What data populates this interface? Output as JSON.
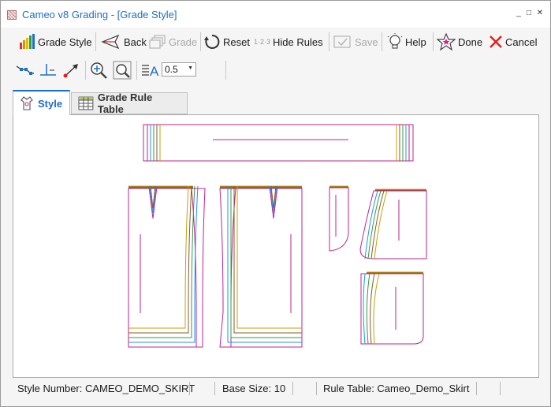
{
  "window": {
    "title": "Cameo v8 Grading - [Grade Style]",
    "controls": [
      "_",
      "□",
      "✕"
    ]
  },
  "toolbar": {
    "grade_style": "Grade Style",
    "back": "Back",
    "grade": "Grade",
    "reset": "Reset",
    "hide_rules_prefix": "1·2·3",
    "hide_rules": "Hide Rules",
    "save": "Save",
    "help": "Help",
    "done": "Done",
    "cancel": "Cancel"
  },
  "toolbar2": {
    "scale_value": "0.5"
  },
  "tabs": {
    "style": "Style",
    "grade_rule_table": "Grade Rule Table"
  },
  "status": {
    "style_number": "Style Number: CAMEO_DEMO_SKIRT",
    "base_size": "Base Size: 10",
    "rule_table": "Rule Table: Cameo_Demo_Skirt"
  },
  "colors": {
    "accent": "#1e6ec7",
    "pattern_base": "#c0238a",
    "grade_lines": [
      "#1e90ff",
      "#2e9e3e",
      "#8b5a2b",
      "#c8a000",
      "#c0238a"
    ]
  }
}
